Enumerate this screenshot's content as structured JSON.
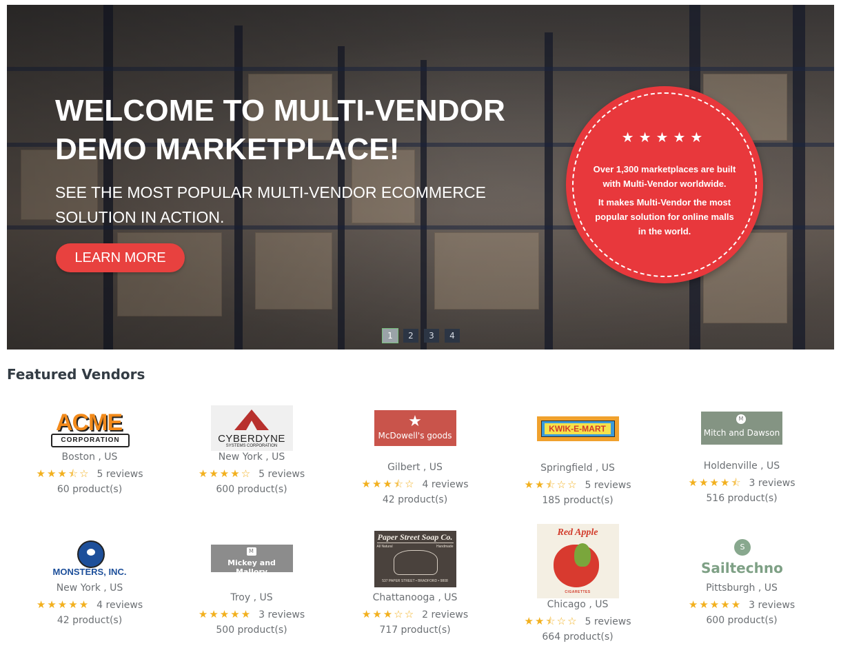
{
  "hero": {
    "title": "WELCOME TO MULTI-VENDOR DEMO MARKETPLACE!",
    "subtitle": "SEE THE MOST POPULAR MULTI-VENDOR ECOMMERCE SOLUTION IN ACTION.",
    "cta_label": "LEARN MORE",
    "badge": {
      "stars": "★★★★★",
      "line1": "Over 1,300 marketplaces are built with Multi-Vendor worldwide.",
      "line2": "It makes Multi-Vendor the most popular solution for online malls in the world."
    },
    "pager": [
      "1",
      "2",
      "3",
      "4"
    ],
    "active_page": "1",
    "accent_color": "#e8413f"
  },
  "featured": {
    "title": "Featured Vendors",
    "vendors": [
      {
        "logo": "ACME CORPORATION",
        "logo_word": "ACME",
        "logo_sub": "CORPORATION",
        "location": "Boston , US",
        "rating": 3.5,
        "reviews": "5 reviews",
        "products": "60 product(s)"
      },
      {
        "logo": "CYBERDYNE SYSTEMS CORPORATION",
        "logo_word": "CYBERDYNE",
        "logo_sub": "SYSTEMS CORPORATION",
        "location": "New York , US",
        "rating": 4,
        "reviews": "5 reviews",
        "products": "600 product(s)"
      },
      {
        "logo": "McDowell's goods",
        "logo_word": "McDowell's goods",
        "location": "Gilbert , US",
        "rating": 3.5,
        "reviews": "4 reviews",
        "products": "42 product(s)"
      },
      {
        "logo": "KWIK-E-MART",
        "logo_word": "KWIK-E-MART",
        "location": "Springfield , US",
        "rating": 2.5,
        "reviews": "5 reviews",
        "products": "185 product(s)"
      },
      {
        "logo": "Mitch and Dawson",
        "logo_word": "Mitch and Dawson",
        "logo_mark": "M",
        "location": "Holdenville , US",
        "rating": 4.5,
        "reviews": "3 reviews",
        "products": "516 product(s)"
      },
      {
        "logo": "MONSTERS, INC.",
        "logo_word": "MONSTERS, INC.",
        "location": "New York , US",
        "rating": 5,
        "reviews": "4 reviews",
        "products": "42 product(s)"
      },
      {
        "logo": "Mickey and Mallory",
        "logo_word": "Mickey and Mallory",
        "logo_mark": "M",
        "location": "Troy , US",
        "rating": 5,
        "reviews": "3 reviews",
        "products": "500 product(s)"
      },
      {
        "logo": "Paper Street Soap Co.",
        "logo_word": "Paper Street Soap Co.",
        "logo_left": "All Natural",
        "logo_right": "Handmade",
        "logo_foot": "537 PAPER STREET • BRADFORD • 9808",
        "location": "Chattanooga , US",
        "rating": 3,
        "reviews": "2 reviews",
        "products": "717 product(s)"
      },
      {
        "logo": "Red Apple Cigarettes",
        "logo_word": "Red Apple",
        "logo_foot": "CIGARETTES",
        "location": "Chicago , US",
        "rating": 2.5,
        "reviews": "5 reviews",
        "products": "664 product(s)"
      },
      {
        "logo": "Sailtechno",
        "logo_word": "Sailtechno",
        "logo_mark": "S",
        "location": "Pittsburgh , US",
        "rating": 5,
        "reviews": "3 reviews",
        "products": "600 product(s)"
      }
    ]
  }
}
